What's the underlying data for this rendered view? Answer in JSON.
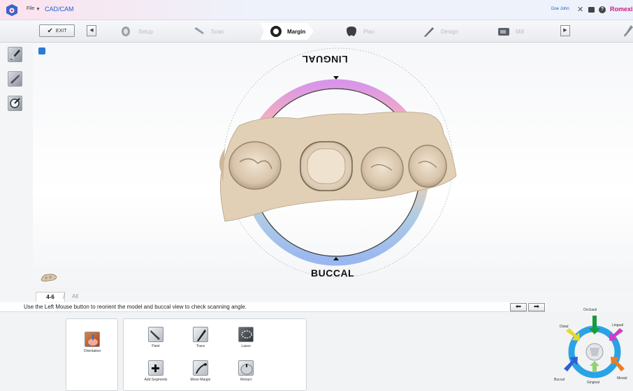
{
  "titlebar": {
    "file_menu": "File",
    "app_name": "CAD/CAM",
    "user": "Doe John",
    "brand": "Romexi"
  },
  "workflow": {
    "exit_label": "EXIT",
    "steps": [
      {
        "label": "Setup",
        "state": "inactive"
      },
      {
        "label": "Scan",
        "state": "inactive"
      },
      {
        "label": "Margin",
        "state": "active"
      },
      {
        "label": "Plan",
        "state": "inactive"
      },
      {
        "label": "Design",
        "state": "inactive"
      },
      {
        "label": "Mill",
        "state": "inactive"
      }
    ]
  },
  "viewport": {
    "label_top": "LINGUAL",
    "label_bottom": "BUCCAL"
  },
  "tabs": [
    {
      "label": "4-6",
      "active": true
    },
    {
      "label": "All",
      "active": false
    }
  ],
  "instruction": "Use the Left Mouse button to reorient the model and buccal view to check scanning angle.",
  "tools": {
    "orientation": "Orientation",
    "paint": "Paint",
    "trace": "Trace",
    "lasso": "Lasso",
    "add_segments": "Add Segments",
    "move_margin": "Move Margin",
    "retract": "Retract"
  },
  "orientation_wheel": {
    "occlusal": "Occlusal",
    "distal": "Distal",
    "lingual": "Lingual",
    "buccal": "Buccal",
    "gingival": "Gingival",
    "mesial": "Mesial"
  },
  "colors": {
    "accent_blue": "#1a5fd0",
    "brand_magenta": "#d1177e"
  }
}
